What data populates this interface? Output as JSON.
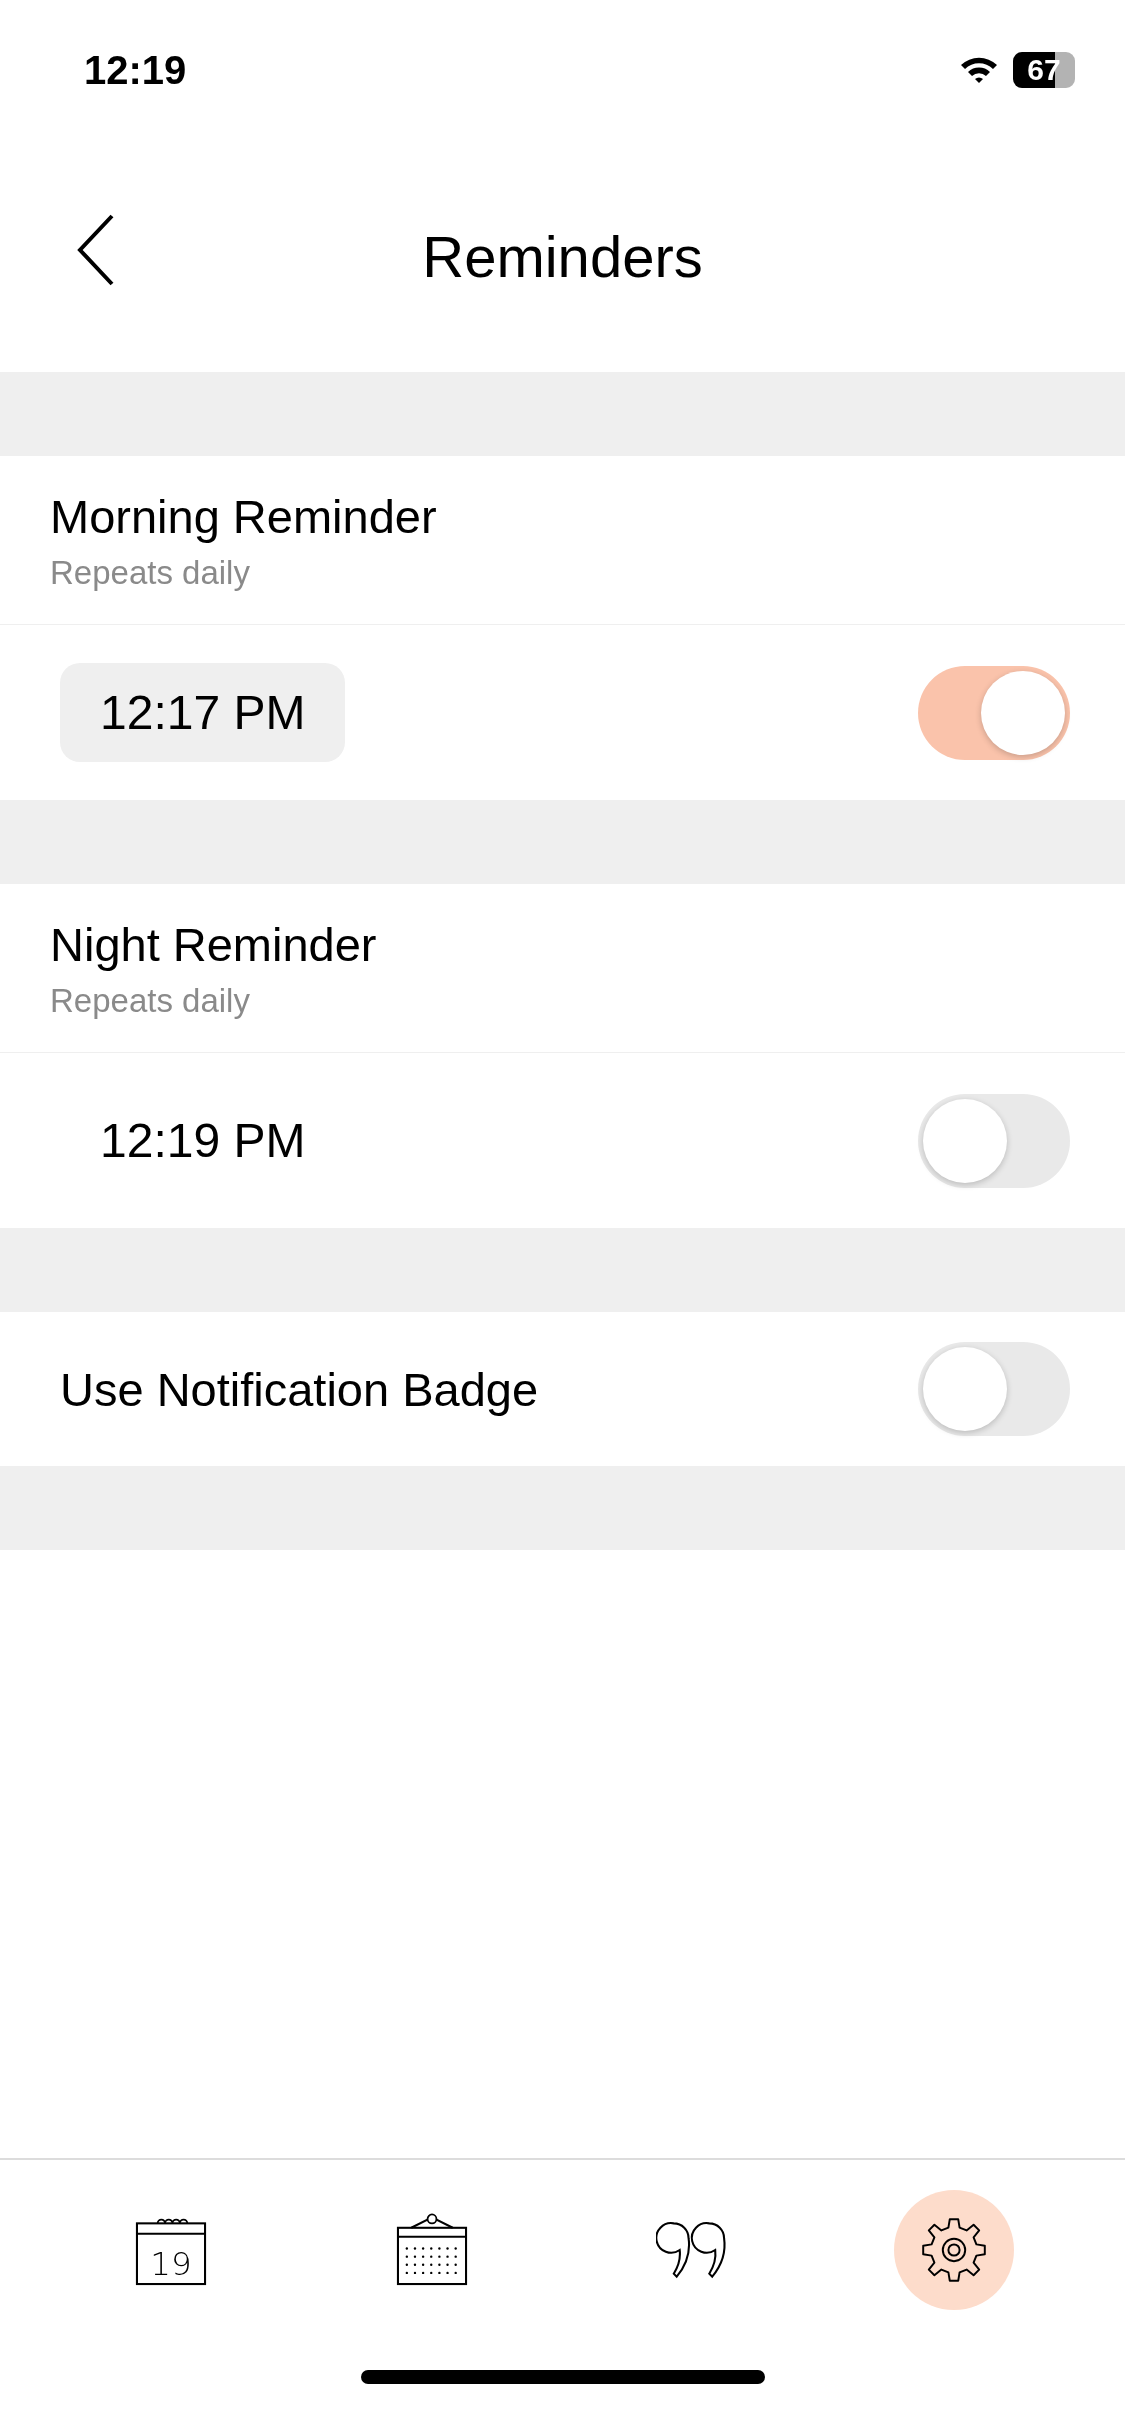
{
  "status_bar": {
    "time": "12:19",
    "battery": "67"
  },
  "nav": {
    "title": "Reminders"
  },
  "reminders": [
    {
      "title": "Morning Reminder",
      "subtitle": "Repeats daily",
      "time": "12:17 PM",
      "highlighted": true,
      "on": true
    },
    {
      "title": "Night Reminder",
      "subtitle": "Repeats daily",
      "time": "12:19 PM",
      "highlighted": false,
      "on": false
    }
  ],
  "badge_setting": {
    "label": "Use Notification Badge",
    "on": false
  },
  "tab_bar": [
    {
      "kind": "day",
      "day": "19",
      "selected": false
    },
    {
      "kind": "calendar",
      "selected": false
    },
    {
      "kind": "quote",
      "selected": false
    },
    {
      "kind": "settings",
      "selected": true
    }
  ]
}
